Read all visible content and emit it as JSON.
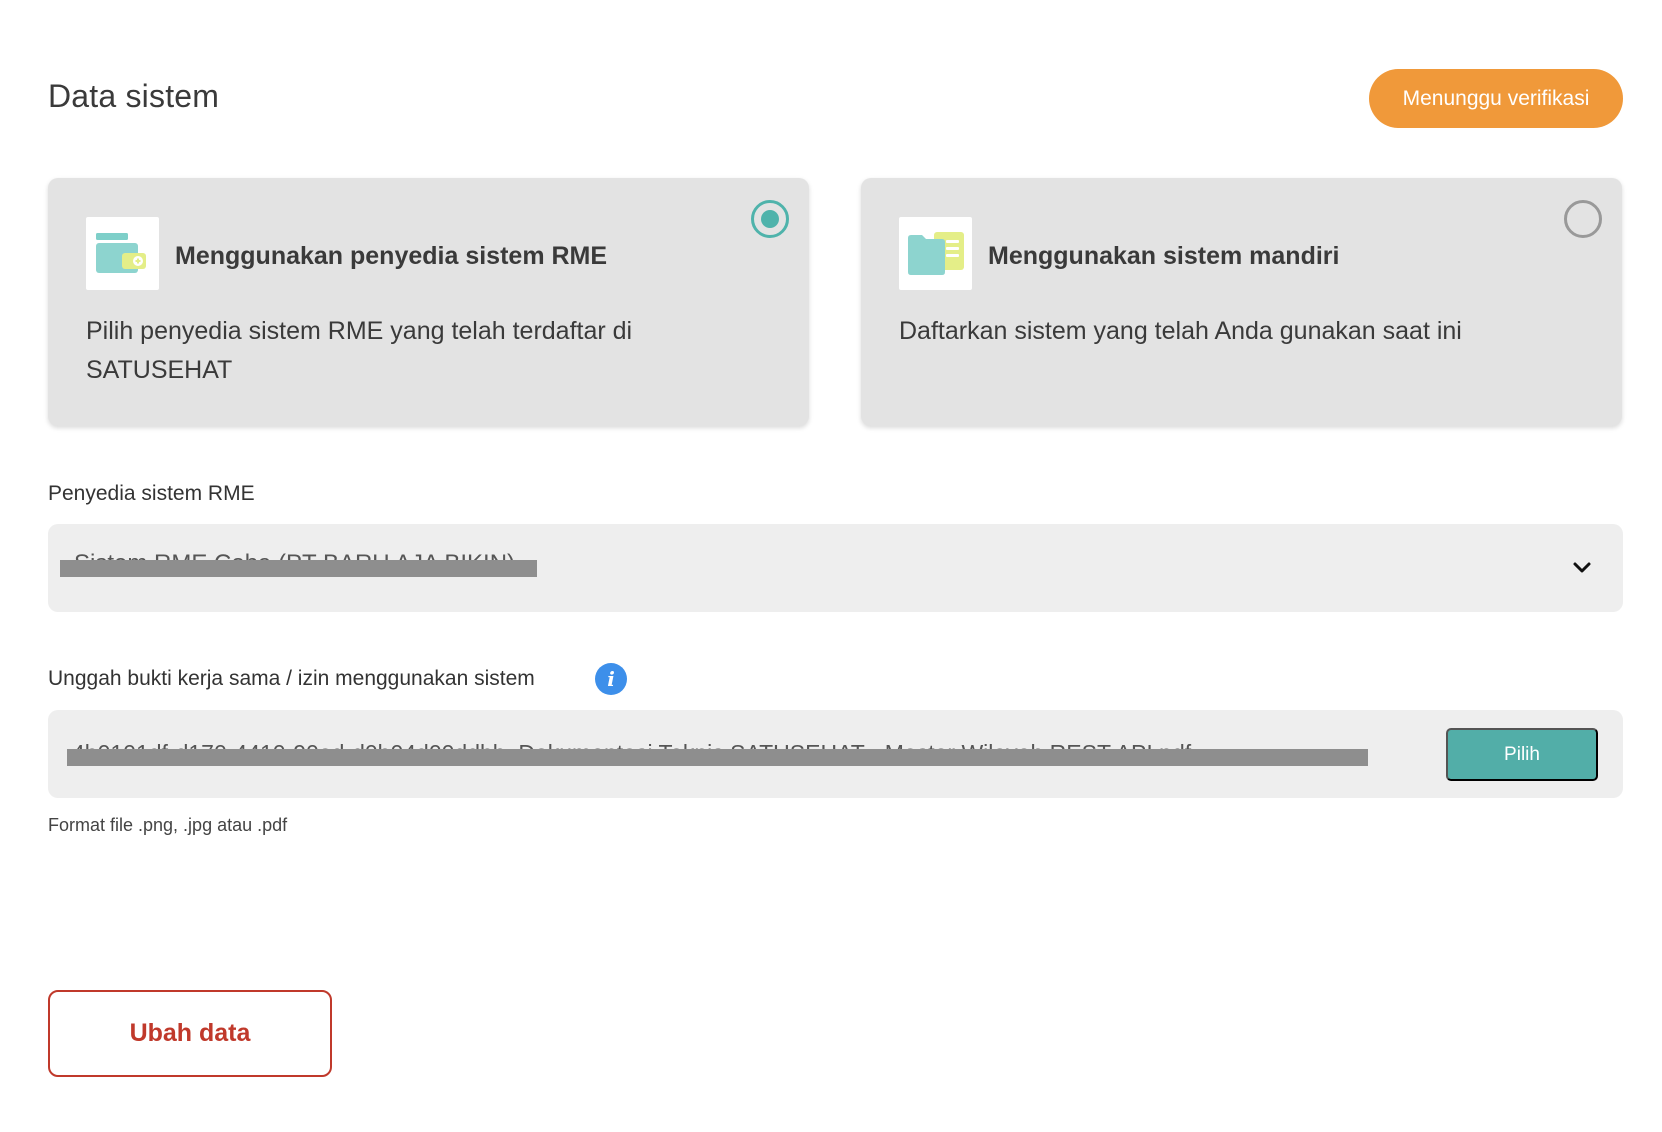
{
  "header": {
    "title": "Data sistem",
    "status_badge": "Menunggu verifikasi",
    "status_color": "#F0993A"
  },
  "options": [
    {
      "title": "Menggunakan penyedia sistem RME",
      "description": "Pilih penyedia sistem RME yang telah terdaftar di SATUSEHAT",
      "selected": true,
      "icon": "wallet-card-icon"
    },
    {
      "title": "Menggunakan sistem mandiri",
      "description": "Daftarkan sistem yang telah Anda gunakan saat ini",
      "selected": false,
      "icon": "folder-document-icon"
    }
  ],
  "provider_field": {
    "label": "Penyedia sistem RME",
    "value": "Sistem RME Coba (PT BARU AJA BIKIN)",
    "icon": "chevron-down-icon"
  },
  "upload_field": {
    "label": "Unggah bukti kerja sama / izin menggunakan sistem",
    "info_icon": "info-icon",
    "value": "4b0101df-d170-4410-90ad-d0b04d00ddbb_Dokumentasi Teknis SATUSEHAT - Master Wilayah REST API.pdf",
    "button_label": "Pilih",
    "helper": "Format file .png, .jpg atau .pdf"
  },
  "actions": {
    "edit_label": "Ubah data"
  },
  "colors": {
    "accent": "#52AEA8",
    "danger": "#C0392B",
    "info": "#3D8FEA"
  }
}
